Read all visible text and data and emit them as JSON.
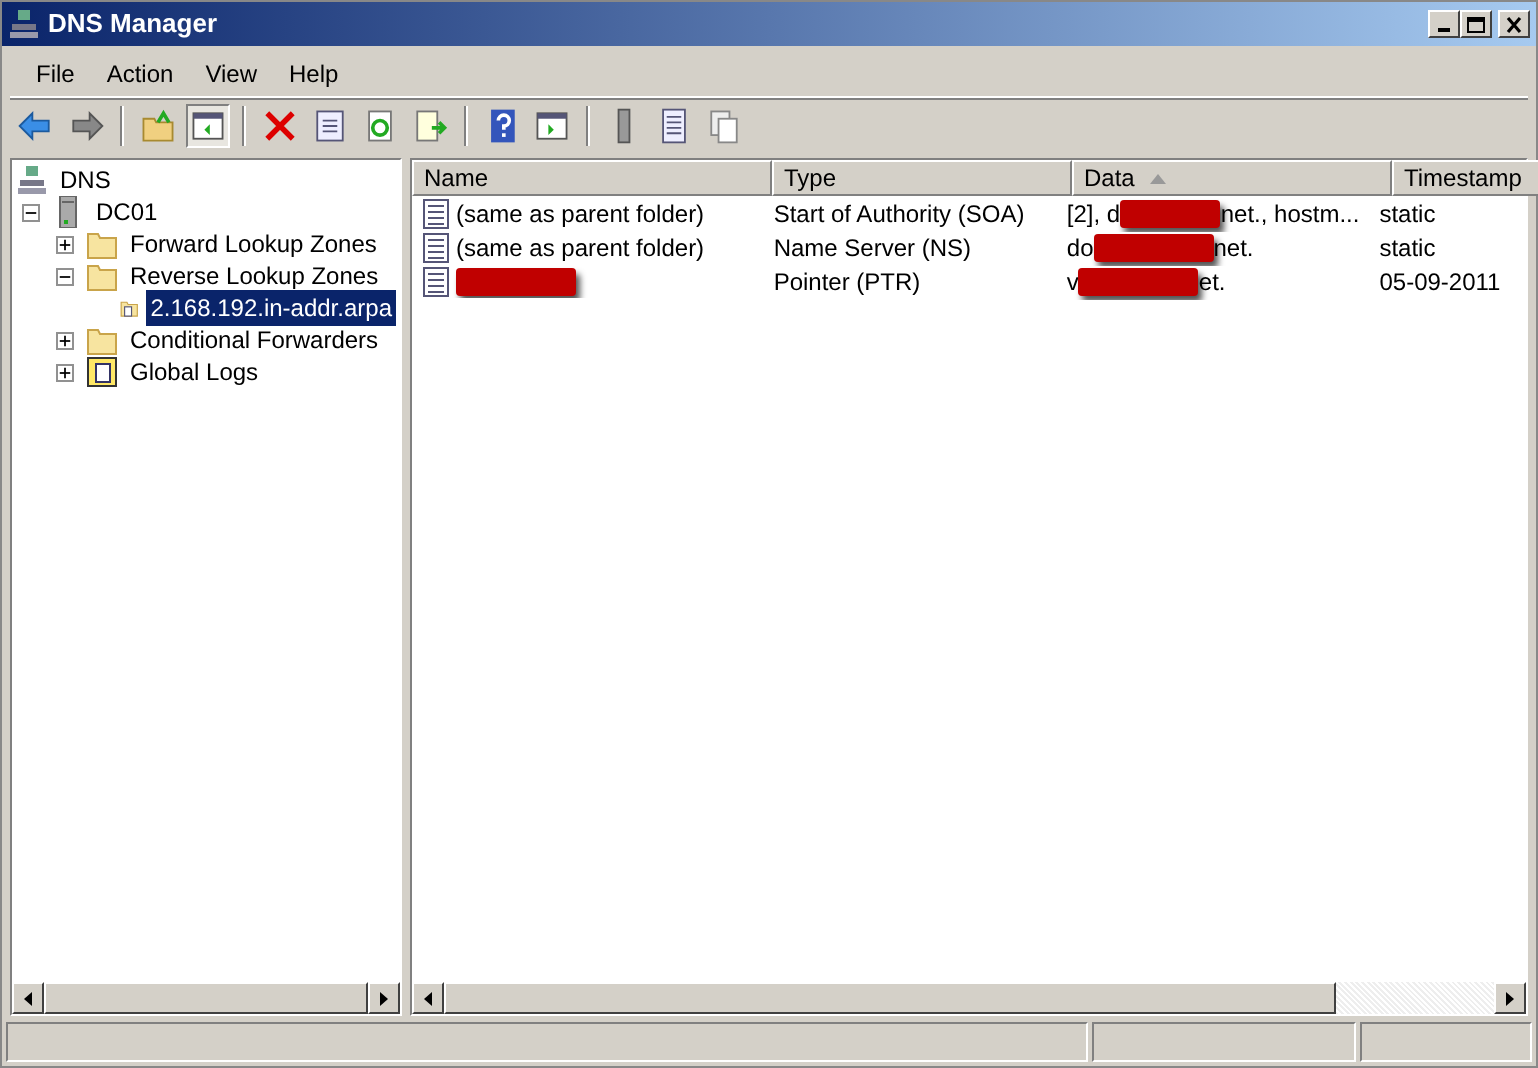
{
  "window": {
    "title": "DNS Manager"
  },
  "menu": [
    "File",
    "Action",
    "View",
    "Help"
  ],
  "toolbar": [
    {
      "kind": "back",
      "pressed": false
    },
    {
      "kind": "forward",
      "pressed": false
    },
    {
      "kind": "sep"
    },
    {
      "kind": "up",
      "pressed": false
    },
    {
      "kind": "tree",
      "pressed": true
    },
    {
      "kind": "sep"
    },
    {
      "kind": "delete",
      "pressed": false
    },
    {
      "kind": "properties",
      "pressed": false
    },
    {
      "kind": "refresh",
      "pressed": false
    },
    {
      "kind": "export",
      "pressed": false
    },
    {
      "kind": "sep"
    },
    {
      "kind": "help",
      "pressed": false
    },
    {
      "kind": "pane",
      "pressed": false
    },
    {
      "kind": "sep"
    },
    {
      "kind": "server",
      "pressed": false
    },
    {
      "kind": "list",
      "pressed": false
    },
    {
      "kind": "copy",
      "pressed": false
    }
  ],
  "tree": [
    {
      "label": "DNS",
      "kind": "dns",
      "selected": false,
      "children": [
        {
          "label": "DC01",
          "kind": "server",
          "expanded": true,
          "selected": false,
          "children": [
            {
              "label": "Forward Lookup Zones",
              "kind": "folder",
              "expanded": false,
              "selected": false
            },
            {
              "label": "Reverse Lookup Zones",
              "kind": "folder",
              "expanded": true,
              "selected": false,
              "children": [
                {
                  "label": "2.168.192.in-addr.arpa",
                  "kind": "zone",
                  "selected": true
                }
              ]
            },
            {
              "label": "Conditional Forwarders",
              "kind": "folder",
              "expanded": false,
              "selected": false
            },
            {
              "label": "Global Logs",
              "kind": "log",
              "expanded": false,
              "selected": false
            }
          ]
        }
      ]
    }
  ],
  "table": {
    "columns": [
      {
        "label": "Name",
        "sorted": false
      },
      {
        "label": "Type",
        "sorted": false
      },
      {
        "label": "Data",
        "sorted": true
      },
      {
        "label": "Timestamp",
        "sorted": false
      }
    ],
    "rows": [
      {
        "name": [
          {
            "kind": "text",
            "text": "(same as parent folder)"
          }
        ],
        "type": "Start of Authority (SOA)",
        "data": [
          {
            "kind": "text",
            "text": "[2], d"
          },
          {
            "kind": "redacted"
          },
          {
            "kind": "text",
            "text": "net., hostm..."
          }
        ],
        "timestamp": "static"
      },
      {
        "name": [
          {
            "kind": "text",
            "text": "(same as parent folder)"
          }
        ],
        "type": "Name Server (NS)",
        "data": [
          {
            "kind": "text",
            "text": "do"
          },
          {
            "kind": "redacted"
          },
          {
            "kind": "text",
            "text": "net."
          }
        ],
        "timestamp": "static"
      },
      {
        "name": [
          {
            "kind": "redacted"
          }
        ],
        "type": "Pointer (PTR)",
        "data": [
          {
            "kind": "text",
            "text": "v"
          },
          {
            "kind": "redacted"
          },
          {
            "kind": "text",
            "text": "et."
          }
        ],
        "timestamp": "05-09-2011"
      }
    ]
  }
}
